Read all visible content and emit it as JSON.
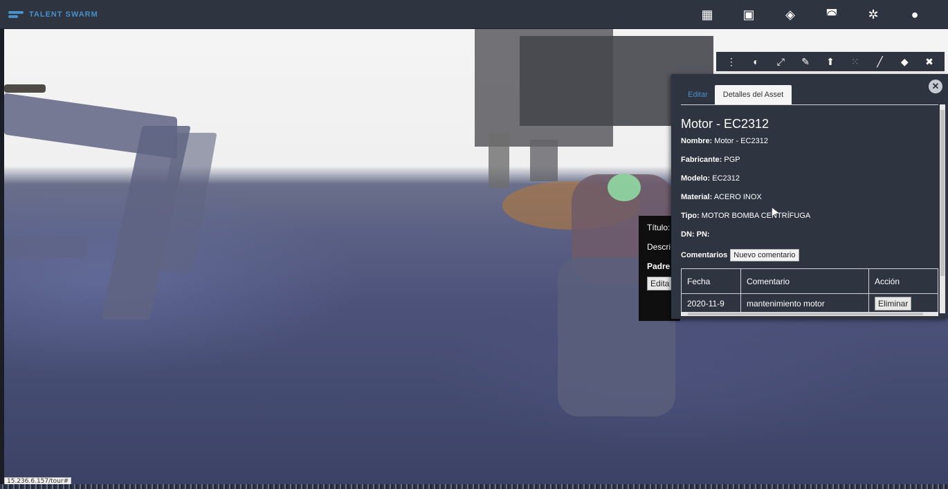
{
  "app": {
    "brand": "TALENT SWARM"
  },
  "topbar": {
    "icons": [
      "grid-icon",
      "image-icon",
      "layers-icon",
      "panorama-icon",
      "settings-icon",
      "user-icon"
    ]
  },
  "toolbar2": {
    "icons": [
      "more-icon",
      "contrast-icon",
      "fullscreen-icon",
      "measure-icon",
      "upload-icon",
      "pointcloud-icon",
      "line-icon",
      "tag-icon",
      "close-icon"
    ]
  },
  "popup": {
    "titulo_label": "Título:",
    "descr_label": "Descri",
    "padre_label": "Padre",
    "editar_label": "Edita"
  },
  "panel": {
    "tabs": [
      "Editar",
      "Detalles del Asset"
    ],
    "title": "Motor - EC2312",
    "fields": [
      {
        "label": "Nombre:",
        "value": "Motor - EC2312"
      },
      {
        "label": "Fabricante:",
        "value": "PGP"
      },
      {
        "label": "Modelo:",
        "value": "EC2312"
      },
      {
        "label": "Material:",
        "value": "ACERO INOX"
      },
      {
        "label": "Tipo:",
        "value": "MOTOR BOMBA CENTRÍFUGA"
      },
      {
        "label": "DN: PN:",
        "value": ""
      }
    ],
    "comentarios_label": "Comentarios",
    "nuevo_comentario": "Nuevo comentario",
    "table": {
      "headers": [
        "Fecha",
        "Comentario",
        "Acción"
      ],
      "rows": [
        {
          "fecha": "2020-11-9",
          "comentario": "mantenimiento motor",
          "accion": "Eliminar"
        }
      ]
    }
  },
  "status_url": "15.236.6.157/tour#"
}
